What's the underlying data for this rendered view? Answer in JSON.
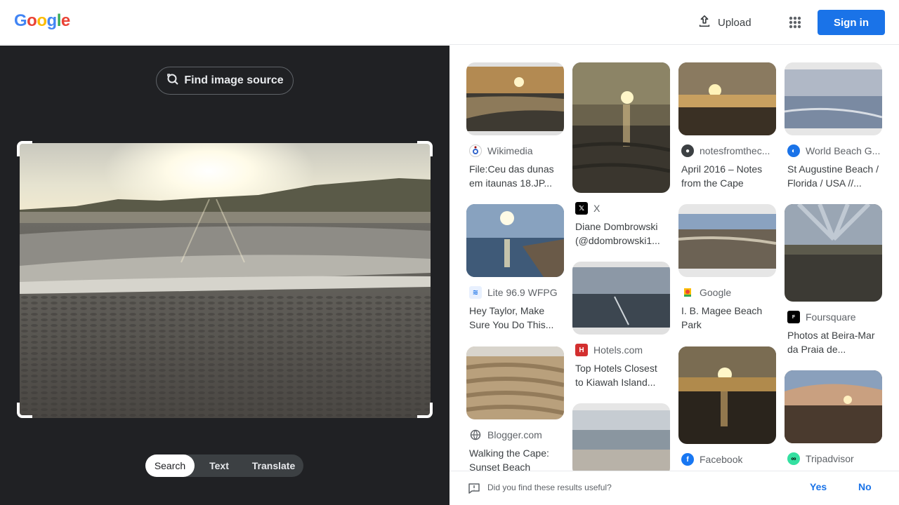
{
  "header": {
    "logo_letters": [
      {
        "ch": "G",
        "color": "#4285f4"
      },
      {
        "ch": "o",
        "color": "#ea4335"
      },
      {
        "ch": "o",
        "color": "#fbbc05"
      },
      {
        "ch": "g",
        "color": "#4285f4"
      },
      {
        "ch": "l",
        "color": "#34a853"
      },
      {
        "ch": "e",
        "color": "#ea4335"
      }
    ],
    "upload_label": "Upload",
    "apps_icon": "apps-grid-icon",
    "signin_label": "Sign in",
    "accent": "#1a73e8"
  },
  "left_panel": {
    "find_source_label": "Find image source",
    "modes": [
      {
        "label": "Search",
        "active": true
      },
      {
        "label": "Text",
        "active": false
      },
      {
        "label": "Translate",
        "active": false
      }
    ]
  },
  "results": [
    {
      "col": 0,
      "source": "Wikimedia",
      "favicon": "wikimedia-icon",
      "title": "File:Ceu das dunas em itaunas 18.JP...",
      "scene": "sunset-beach-1"
    },
    {
      "col": 0,
      "source": "Lite 96.9 WFPG",
      "favicon": "radio-icon",
      "title": "Hey Taylor, Make Sure You Do This...",
      "scene": "sunset-sea-2"
    },
    {
      "col": 0,
      "source": "Blogger.com",
      "favicon": "globe-icon",
      "title": "Walking the Cape: Sunset Beach",
      "scene": "sand-ripples"
    },
    {
      "col": 1,
      "source": "X",
      "favicon": "x-icon",
      "title": "Diane Dombrowski (@ddombrowski1...",
      "scene": "tall-sunset"
    },
    {
      "col": 1,
      "source": "Hotels.com",
      "favicon": "hotels-icon",
      "title": "Top Hotels Closest to Kiawah Island...",
      "scene": "cloudy-shore"
    },
    {
      "col": 1,
      "source": "",
      "favicon": "",
      "title": "",
      "scene": "surf"
    },
    {
      "col": 2,
      "source": "notesfromthec...",
      "favicon": "notes-icon",
      "title": "April 2016 – Notes from the Cape",
      "scene": "gold-sunset"
    },
    {
      "col": 2,
      "source": "Google",
      "favicon": "google-icon",
      "title": "I. B. Magee Beach Park",
      "scene": "wet-sand"
    },
    {
      "col": 2,
      "source": "Facebook",
      "favicon": "facebook-icon",
      "title": "",
      "scene": "sunset-dark"
    },
    {
      "col": 3,
      "source": "World Beach G...",
      "favicon": "worldbeach-icon",
      "title": "St Augustine Beach / Florida / USA //...",
      "scene": "calm-blue"
    },
    {
      "col": 3,
      "source": "Foursquare",
      "favicon": "foursquare-icon",
      "title": "Photos at Beira-Mar da Praia de...",
      "scene": "rays"
    },
    {
      "col": 3,
      "source": "Tripadvisor",
      "favicon": "tripadvisor-icon",
      "title": "",
      "scene": "orange-clouds"
    }
  ],
  "feedback": {
    "question": "Did you find these results useful?",
    "yes_label": "Yes",
    "no_label": "No"
  }
}
